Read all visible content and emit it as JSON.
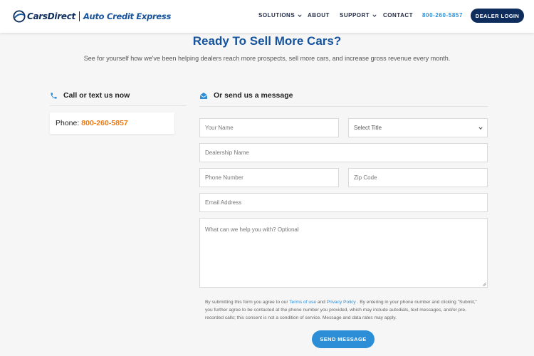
{
  "header": {
    "logo_primary": "CarsDirect",
    "logo_secondary": "Auto Credit Express",
    "nav": [
      {
        "label": "SOLUTIONS",
        "dropdown": true
      },
      {
        "label": "ABOUT",
        "dropdown": false
      },
      {
        "label": "SUPPORT",
        "dropdown": true
      },
      {
        "label": "CONTACT",
        "dropdown": false
      }
    ],
    "phone": "800-260-5857",
    "login_label": "DEALER LOGIN"
  },
  "hero": {
    "title": "Ready To Sell More Cars?",
    "subtitle": "See for yourself how we've been helping dealers reach more prospects, sell more cars, and increase gross revenue every month."
  },
  "call": {
    "heading": "Call or text us now",
    "phone_label": "Phone:",
    "phone_number": "800-260-5857"
  },
  "form": {
    "heading": "Or send us a message",
    "name_placeholder": "Your Name",
    "title_select": "Select Title",
    "dealership_placeholder": "Dealership Name",
    "phone_placeholder": "Phone Number",
    "zip_placeholder": "Zip Code",
    "email_placeholder": "Email Address",
    "message_placeholder": "What can we help you with? Optional",
    "disclaimer_1": "By submitting this form you agree to our ",
    "terms_link": "Terms of use",
    "disclaimer_and": " and ",
    "privacy_link": "Privacy Policy",
    "disclaimer_2": " . By entering in your phone number and clicking \"Submit,\" you further agree to be contacted at the phone number you provided, which may include autodials, text messages, and/or pre-recorded calls; this consent is not a condition of service. Message and data rates may apply.",
    "submit_label": "SEND MESSAGE"
  },
  "colors": {
    "brand_navy": "#0e2d5c",
    "brand_blue": "#15539c",
    "accent_blue": "#2b8ed6",
    "accent_orange": "#ea7b14"
  }
}
